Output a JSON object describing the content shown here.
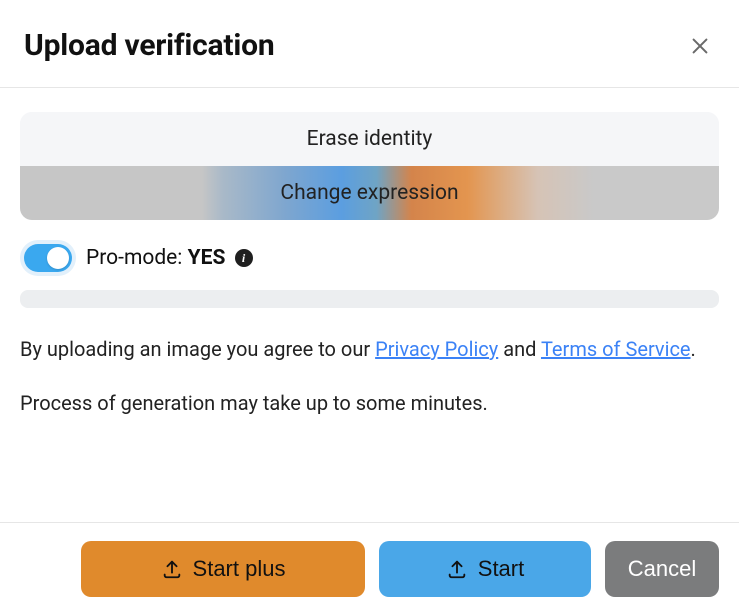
{
  "header": {
    "title": "Upload verification"
  },
  "options": {
    "erase": "Erase identity",
    "change": "Change expression"
  },
  "proMode": {
    "label": "Pro-mode:",
    "state": "YES"
  },
  "disclaimer": {
    "prefix": "By uploading an image you agree to our ",
    "privacy": "Privacy Policy",
    "and": " and ",
    "tos": "Terms of Service",
    "period": "."
  },
  "note": "Process of generation may take up to some minutes.",
  "footer": {
    "startPlus": "Start plus",
    "start": "Start",
    "cancel": "Cancel"
  }
}
